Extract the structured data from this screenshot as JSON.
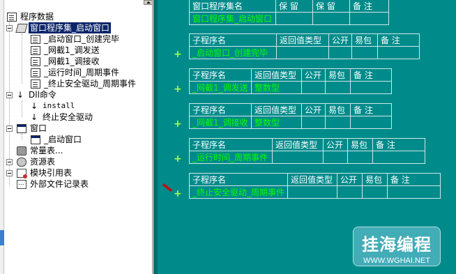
{
  "tree": {
    "root_label": "程序数据",
    "window_program_set": "窗口程序集_启动窗口",
    "subs": [
      "_启动窗口_创建完毕",
      "_网截1_调发送",
      "_网截1_调接收",
      "_运行时间_周期事件",
      "_终止安全驱动_周期事件"
    ],
    "dll_label": "Dll命令",
    "dll_items": [
      "install",
      "终止安全驱动"
    ],
    "windows_label": "窗口",
    "window_item": "_启动窗口",
    "constants_label": "常量表...",
    "resources_label": "资源表",
    "modules_label": "模块引用表",
    "external_files_label": "外部文件记录表"
  },
  "editor": {
    "program_set_header": [
      "窗口程序集名",
      "保 留",
      "保 留",
      "备 注"
    ],
    "program_set_row": [
      "窗口程序集_启动窗口",
      "",
      "",
      ""
    ],
    "sub_header": [
      "子程序名",
      "返回值类型",
      "公开",
      "易包",
      "备 注"
    ],
    "subs": [
      {
        "name": "_启动窗口_创建完毕",
        "return_type": ""
      },
      {
        "name": "_网截1_调发送",
        "return_type": "整数型"
      },
      {
        "name": "_网截1_调接收",
        "return_type": "整数型"
      },
      {
        "name": "_运行时间_周期事件",
        "return_type": ""
      },
      {
        "name": "_终止安全驱动_周期事件",
        "return_type": ""
      }
    ],
    "plus_glyph": "+"
  },
  "watermark": {
    "title": "挂海编程",
    "url": "WWW.WGHAI.NET"
  },
  "colors": {
    "editor_bg": "#008b8b",
    "header_text": "#ffffff",
    "value_text": "#00ff00",
    "selection_bg": "#0a246a"
  }
}
